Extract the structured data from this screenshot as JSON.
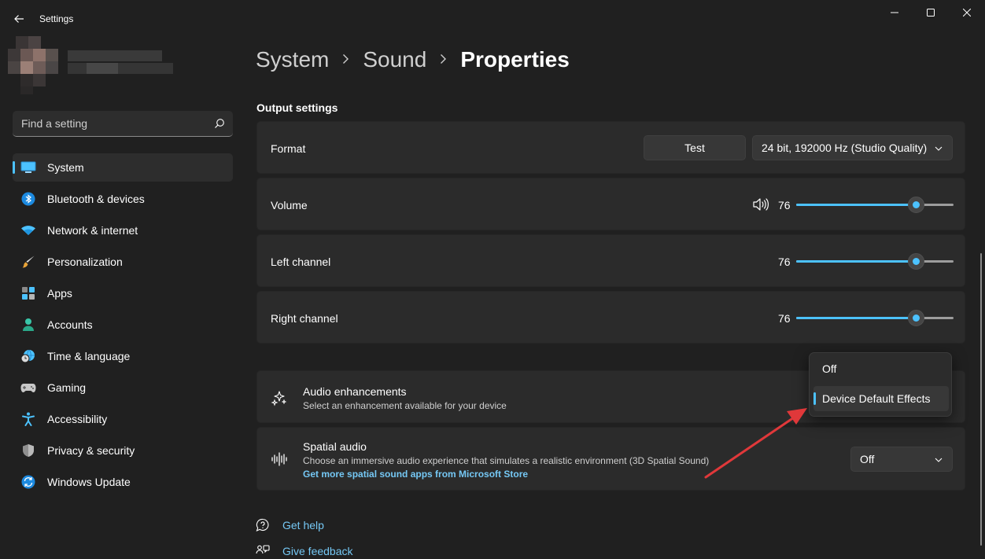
{
  "window": {
    "title": "Settings"
  },
  "search": {
    "placeholder": "Find a setting"
  },
  "sidebar": {
    "items": [
      {
        "label": "System",
        "icon": "system-icon",
        "active": true
      },
      {
        "label": "Bluetooth & devices",
        "icon": "bluetooth-icon",
        "active": false
      },
      {
        "label": "Network & internet",
        "icon": "wifi-icon",
        "active": false
      },
      {
        "label": "Personalization",
        "icon": "brush-icon",
        "active": false
      },
      {
        "label": "Apps",
        "icon": "apps-icon",
        "active": false
      },
      {
        "label": "Accounts",
        "icon": "person-icon",
        "active": false
      },
      {
        "label": "Time & language",
        "icon": "globe-clock-icon",
        "active": false
      },
      {
        "label": "Gaming",
        "icon": "gamepad-icon",
        "active": false
      },
      {
        "label": "Accessibility",
        "icon": "accessibility-icon",
        "active": false
      },
      {
        "label": "Privacy & security",
        "icon": "shield-icon",
        "active": false
      },
      {
        "label": "Windows Update",
        "icon": "update-icon",
        "active": false
      }
    ]
  },
  "breadcrumb": {
    "items": [
      "System",
      "Sound"
    ],
    "current": "Properties"
  },
  "output": {
    "section_title": "Output settings",
    "format": {
      "label": "Format",
      "test_label": "Test",
      "selected": "24 bit, 192000 Hz (Studio Quality)"
    },
    "volume": {
      "label": "Volume",
      "value": 76
    },
    "left_channel": {
      "label": "Left channel",
      "value": 76
    },
    "right_channel": {
      "label": "Right channel",
      "value": 76
    }
  },
  "enhancements": {
    "title": "Audio enhancements",
    "description": "Select an enhancement available for your device",
    "options": [
      "Off",
      "Device Default Effects"
    ],
    "selected": "Device Default Effects"
  },
  "spatial": {
    "title": "Spatial audio",
    "description": "Choose an immersive audio experience that simulates a realistic environment (3D Spatial Sound)",
    "link": "Get more spatial sound apps from Microsoft Store",
    "selected": "Off"
  },
  "footer": {
    "help": "Get help",
    "feedback": "Give feedback"
  },
  "colors": {
    "accent": "#4cc2ff",
    "annotation_arrow": "#e0383a"
  }
}
